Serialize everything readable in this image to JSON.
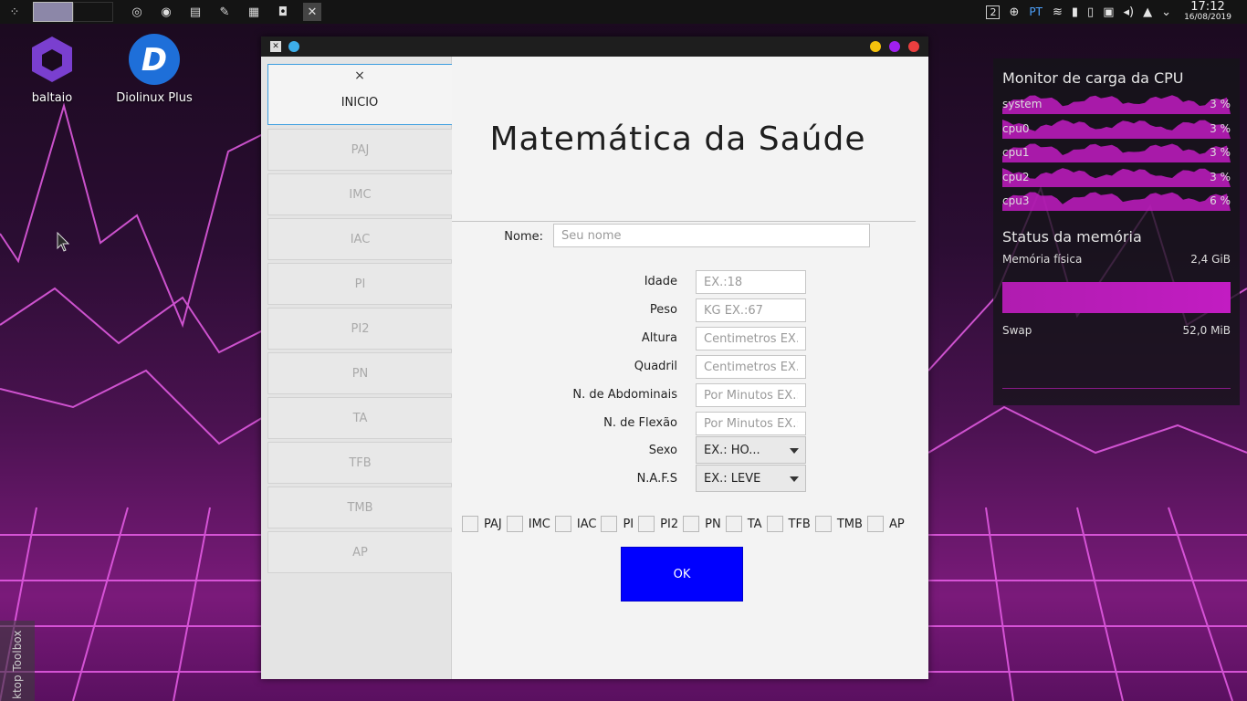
{
  "desktop": {
    "icons": [
      {
        "label": "baltaio",
        "icon": "baltaio-icon"
      },
      {
        "label": "Diolinux Plus",
        "icon": "diolinux-icon"
      }
    ],
    "toolbox_label": "ktop Toolbox"
  },
  "panel": {
    "workspace_num": "2",
    "lang": "PT",
    "time": "17:12",
    "date": "16/08/2019"
  },
  "cpu_widget": {
    "title": "Monitor de carga da CPU",
    "rows": [
      {
        "name": "system",
        "value": "3 %"
      },
      {
        "name": "cpu0",
        "value": "3 %"
      },
      {
        "name": "cpu1",
        "value": "3 %"
      },
      {
        "name": "cpu2",
        "value": "3 %"
      },
      {
        "name": "cpu3",
        "value": "6 %"
      }
    ],
    "mem_title": "Status da memória",
    "phys_label": "Memória física",
    "phys_value": "2,4 GiB",
    "swap_label": "Swap",
    "swap_value": "52,0 MiB",
    "accent": "#c21cc2"
  },
  "app": {
    "title": "Matemática da Saúde",
    "side_close": "×",
    "side_active": "INICIO",
    "side_items": [
      "PAJ",
      "IMC",
      "IAC",
      "PI",
      "PI2",
      "PN",
      "TA",
      "TFB",
      "TMB",
      "AP"
    ],
    "nome_label": "Nome:",
    "nome_placeholder": "Seu nome",
    "fields": [
      {
        "label": "Idade",
        "placeholder": "EX.:18"
      },
      {
        "label": "Peso",
        "placeholder": "KG EX.:67"
      },
      {
        "label": "Altura",
        "placeholder": "Centimetros EX.:"
      },
      {
        "label": "Quadril",
        "placeholder": "Centimetros EX.:"
      },
      {
        "label": "N. de Abdominais",
        "placeholder": "Por Minutos EX.:"
      },
      {
        "label": "N. de Flexão",
        "placeholder": "Por Minutos EX.:"
      }
    ],
    "sexo_label": "Sexo",
    "sexo_value": "EX.: HO...",
    "nafs_label": "N.A.F.S",
    "nafs_value": "EX.: LEVE",
    "checkboxes": [
      "PAJ",
      "IMC",
      "IAC",
      "PI",
      "PI2",
      "PN",
      "TA",
      "TFB",
      "TMB",
      "AP"
    ],
    "ok_label": "OK",
    "ok_color": "#0000ff"
  }
}
